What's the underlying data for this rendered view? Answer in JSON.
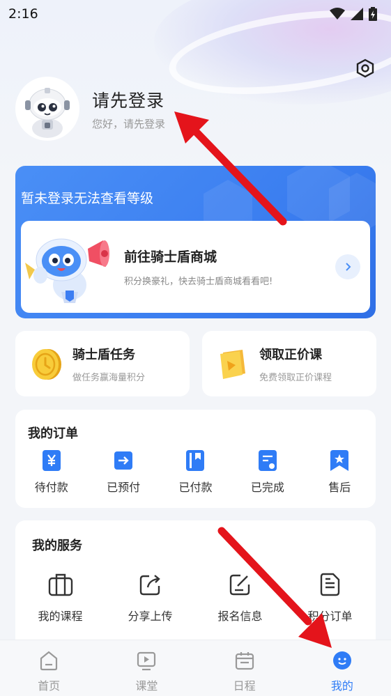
{
  "status_bar": {
    "time": "2:16"
  },
  "profile": {
    "name": "请先登录",
    "subtitle": "您好，请先登录"
  },
  "level_card": {
    "title": "暂未登录无法查看等级",
    "shop": {
      "title": "前往骑士盾商城",
      "subtitle": "积分换豪礼，快去骑士盾商城看看吧!"
    }
  },
  "tasks": [
    {
      "title": "骑士盾任务",
      "subtitle": "做任务赢海量积分",
      "icon": "gold-coin-icon"
    },
    {
      "title": "领取正价课",
      "subtitle": "免费领取正价课程",
      "icon": "book-icon"
    }
  ],
  "orders": {
    "title": "我的订单",
    "items": [
      {
        "label": "待付款",
        "icon": "yen-icon"
      },
      {
        "label": "已预付",
        "icon": "arrow-right-box-icon"
      },
      {
        "label": "已付款",
        "icon": "bookmark-book-icon"
      },
      {
        "label": "已完成",
        "icon": "document-star-icon"
      },
      {
        "label": "售后",
        "icon": "bookmark-star-icon"
      }
    ]
  },
  "services": {
    "title": "我的服务",
    "items": [
      {
        "label": "我的课程",
        "icon": "briefcase-icon"
      },
      {
        "label": "分享上传",
        "icon": "share-icon"
      },
      {
        "label": "报名信息",
        "icon": "edit-form-icon"
      },
      {
        "label": "积分订单",
        "icon": "list-document-icon"
      }
    ]
  },
  "tabbar": {
    "items": [
      {
        "label": "首页",
        "icon": "home-icon"
      },
      {
        "label": "课堂",
        "icon": "video-icon"
      },
      {
        "label": "日程",
        "icon": "calendar-icon"
      },
      {
        "label": "我的",
        "icon": "smiley-icon"
      }
    ],
    "active_index": 3
  },
  "colors": {
    "accent": "#2f7cf6",
    "card_blue": "#3b7ef0",
    "annotation_red": "#e4141b"
  }
}
